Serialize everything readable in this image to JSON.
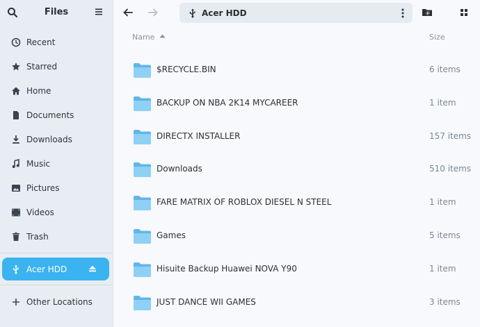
{
  "app": {
    "title": "Files"
  },
  "sidebar": {
    "items": [
      {
        "label": "Recent",
        "icon": "clock-icon"
      },
      {
        "label": "Starred",
        "icon": "star-icon"
      },
      {
        "label": "Home",
        "icon": "home-icon"
      },
      {
        "label": "Documents",
        "icon": "document-icon"
      },
      {
        "label": "Downloads",
        "icon": "download-icon"
      },
      {
        "label": "Music",
        "icon": "music-icon"
      },
      {
        "label": "Pictures",
        "icon": "picture-icon"
      },
      {
        "label": "Videos",
        "icon": "video-icon"
      },
      {
        "label": "Trash",
        "icon": "trash-icon"
      }
    ],
    "device": {
      "label": "Acer HDD",
      "icon": "usb-icon"
    },
    "other_locations": {
      "label": "Other Locations",
      "icon": "plus-icon"
    }
  },
  "pathbar": {
    "location": "Acer HDD"
  },
  "columns": {
    "name": "Name",
    "size": "Size"
  },
  "files": [
    {
      "name": "$RECYCLE.BIN",
      "size": "6 items"
    },
    {
      "name": "BACKUP ON NBA 2K14 MYCAREER",
      "size": "1 item"
    },
    {
      "name": "DIRECTX INSTALLER",
      "size": "157 items"
    },
    {
      "name": "Downloads",
      "size": "510 items"
    },
    {
      "name": "FARE MATRIX OF ROBLOX DIESEL N STEEL",
      "size": "1 item"
    },
    {
      "name": "Games",
      "size": "5 items"
    },
    {
      "name": "Hisuite Backup Huawei NOVA Y90",
      "size": "1 item"
    },
    {
      "name": "JUST DANCE WII GAMES",
      "size": "3 items"
    }
  ],
  "colors": {
    "accent": "#3ab3f0",
    "folder": "#7fc8f2",
    "sidebar_bg": "#e8edf3",
    "content_bg": "#f7f9fc"
  }
}
